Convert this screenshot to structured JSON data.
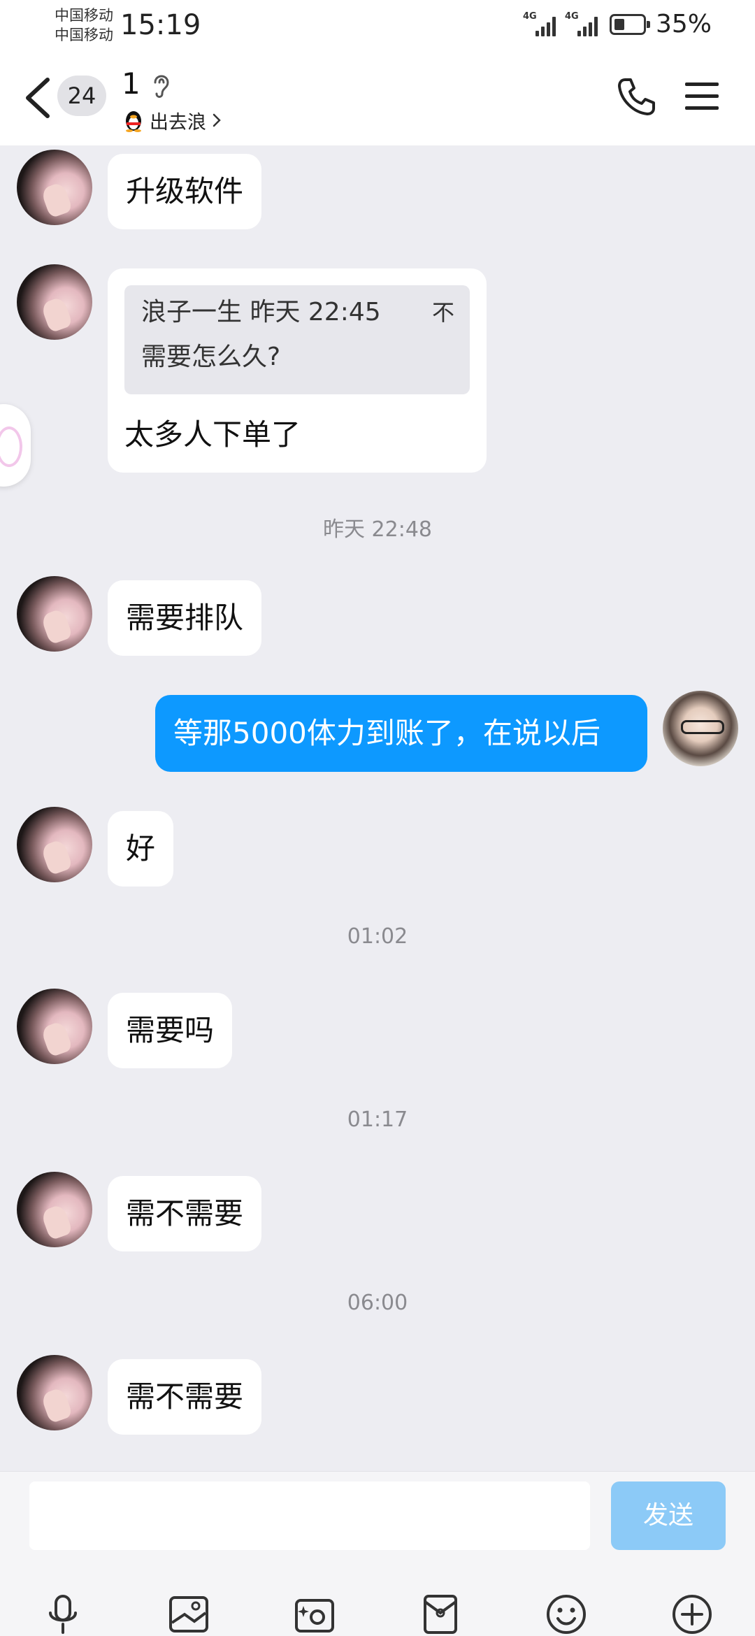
{
  "status_bar": {
    "carrier_1": "中国移动",
    "carrier_2": "中国移动",
    "time": "15:19",
    "network_1": "4G",
    "network_2": "4G",
    "battery": "35%",
    "battery_level": 0.35
  },
  "header": {
    "unread_count": "24",
    "title": "1",
    "subtitle": "出去浪"
  },
  "messages": [
    {
      "from": "other",
      "text": "升级软件"
    },
    {
      "from": "other",
      "quote": {
        "header": "浪子一生 昨天 22:45",
        "text": "需要怎么久?",
        "action": "不"
      },
      "text": "太多人下单了"
    },
    {
      "type": "timestamp",
      "text": "昨天 22:48"
    },
    {
      "from": "other",
      "text": "需要排队"
    },
    {
      "from": "me",
      "text": "等那5000体力到账了，在说以后"
    },
    {
      "from": "other",
      "text": "好"
    },
    {
      "type": "timestamp",
      "text": "01:02"
    },
    {
      "from": "other",
      "text": "需要吗"
    },
    {
      "type": "timestamp",
      "text": "01:17"
    },
    {
      "from": "other",
      "text": "需不需要"
    },
    {
      "type": "timestamp",
      "text": "06:00"
    },
    {
      "from": "other",
      "text": "需不需要"
    }
  ],
  "input": {
    "value": "",
    "send_label": "发送"
  },
  "toolbar_icons": [
    "microphone-icon",
    "image-icon",
    "camera-icon",
    "red-packet-icon",
    "emoji-icon",
    "plus-icon"
  ],
  "colors": {
    "my_bubble": "#0d99ff",
    "send_button": "#8ccaf7",
    "chat_background": "#ededf2"
  }
}
